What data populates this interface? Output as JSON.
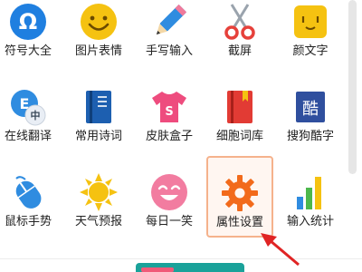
{
  "toolbox": {
    "items": [
      {
        "label": "符号大全",
        "icon": "omega-icon",
        "color": "#1f7fe0"
      },
      {
        "label": "图片表情",
        "icon": "smiley-face-icon",
        "color": "#f5c211"
      },
      {
        "label": "手写输入",
        "icon": "pencil-icon",
        "color": "#2f8ce0"
      },
      {
        "label": "截屏",
        "icon": "scissors-icon",
        "color": "#e6413b"
      },
      {
        "label": "颜文字",
        "icon": "kaomoji-face-icon",
        "color": "#f5c211"
      },
      {
        "label": "在线翻译",
        "icon": "translate-icon",
        "color": "#2f8ce0"
      },
      {
        "label": "常用诗词",
        "icon": "book-icon",
        "color": "#1d5fb0"
      },
      {
        "label": "皮肤盒子",
        "icon": "tshirt-icon",
        "color": "#ee4c7e"
      },
      {
        "label": "细胞词库",
        "icon": "bookmark-book-icon",
        "color": "#e23b34"
      },
      {
        "label": "搜狗酷字",
        "icon": "fancy-text-icon",
        "color": "#2f4f9e"
      },
      {
        "label": "鼠标手势",
        "icon": "mouse-icon",
        "color": "#2f8ce0"
      },
      {
        "label": "天气预报",
        "icon": "sun-icon",
        "color": "#f5c211"
      },
      {
        "label": "每日一笑",
        "icon": "laughing-face-icon",
        "color": "#f27ca0"
      },
      {
        "label": "属性设置",
        "icon": "gear-icon",
        "color": "#f26a1b",
        "selected": true
      },
      {
        "label": "输入统计",
        "icon": "bar-chart-icon",
        "color": "#f5a623"
      }
    ]
  },
  "colors": {
    "selection_border": "#f5b28c",
    "arrow": "#e02424"
  }
}
